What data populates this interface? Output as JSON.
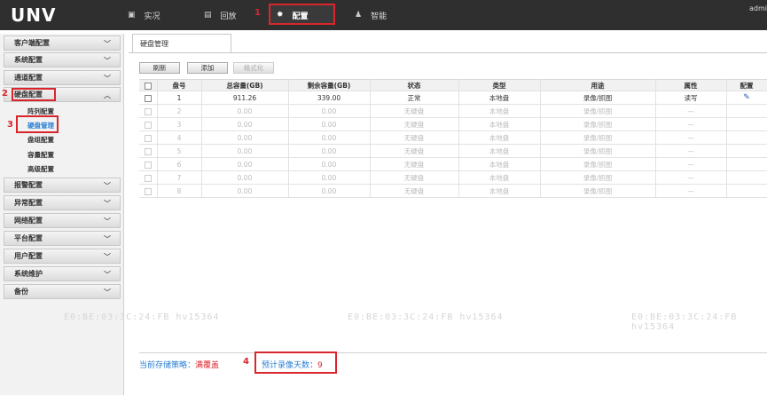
{
  "header": {
    "logo": "UNV",
    "nav": [
      {
        "label": "实况",
        "icon": "monitor-icon"
      },
      {
        "label": "回放",
        "icon": "playback-icon"
      },
      {
        "label": "配置",
        "icon": "gear-icon"
      },
      {
        "label": "智能",
        "icon": "person-icon"
      }
    ],
    "user": "admi"
  },
  "annotations": {
    "a1": "1",
    "a2": "2",
    "a3": "3",
    "a4": "4"
  },
  "sidebar": {
    "items": [
      {
        "label": "客户端配置"
      },
      {
        "label": "系统配置"
      },
      {
        "label": "通道配置"
      },
      {
        "label": "硬盘配置"
      },
      {
        "label": "报警配置"
      },
      {
        "label": "异常配置"
      },
      {
        "label": "网络配置"
      },
      {
        "label": "平台配置"
      },
      {
        "label": "用户配置"
      },
      {
        "label": "系统维护"
      },
      {
        "label": "备份"
      }
    ],
    "sub_items": [
      {
        "label": "阵列配置"
      },
      {
        "label": "硬盘管理"
      },
      {
        "label": "盘组配置"
      },
      {
        "label": "容量配置"
      },
      {
        "label": "高级配置"
      }
    ]
  },
  "main": {
    "tab": "硬盘管理",
    "buttons": {
      "refresh": "刷新",
      "add": "添加",
      "format": "格式化"
    },
    "columns": [
      "盘号",
      "总容量(GB)",
      "剩余容量(GB)",
      "状态",
      "类型",
      "用途",
      "属性",
      "配置"
    ],
    "rows": [
      {
        "id": "1",
        "total": "911.26",
        "free": "339.00",
        "status": "正常",
        "type": "本地盘",
        "usage": "录像/抓图",
        "attr": "读写"
      },
      {
        "id": "2",
        "total": "0.00",
        "free": "0.00",
        "status": "无硬盘",
        "type": "本地盘",
        "usage": "录像/抓图",
        "attr": "—"
      },
      {
        "id": "3",
        "total": "0.00",
        "free": "0.00",
        "status": "无硬盘",
        "type": "本地盘",
        "usage": "录像/抓图",
        "attr": "—"
      },
      {
        "id": "4",
        "total": "0.00",
        "free": "0.00",
        "status": "无硬盘",
        "type": "本地盘",
        "usage": "录像/抓图",
        "attr": "—"
      },
      {
        "id": "5",
        "total": "0.00",
        "free": "0.00",
        "status": "无硬盘",
        "type": "本地盘",
        "usage": "录像/抓图",
        "attr": "—"
      },
      {
        "id": "6",
        "total": "0.00",
        "free": "0.00",
        "status": "无硬盘",
        "type": "本地盘",
        "usage": "录像/抓图",
        "attr": "—"
      },
      {
        "id": "7",
        "total": "0.00",
        "free": "0.00",
        "status": "无硬盘",
        "type": "本地盘",
        "usage": "录像/抓图",
        "attr": "—"
      },
      {
        "id": "8",
        "total": "0.00",
        "free": "0.00",
        "status": "无硬盘",
        "type": "本地盘",
        "usage": "录像/抓图",
        "attr": "—"
      }
    ],
    "edit_icon": "pencil-icon"
  },
  "footer": {
    "policy_label": "当前存储策略：",
    "policy_value": "满覆盖",
    "days_label": "预计录像天数：",
    "days_value": "9"
  },
  "watermark": "E0:BE:03:3C:24:FB hv15364",
  "colors": {
    "accent": "#2a7fd4",
    "highlight": "#d9262c",
    "topbar": "#2f2f2f"
  }
}
